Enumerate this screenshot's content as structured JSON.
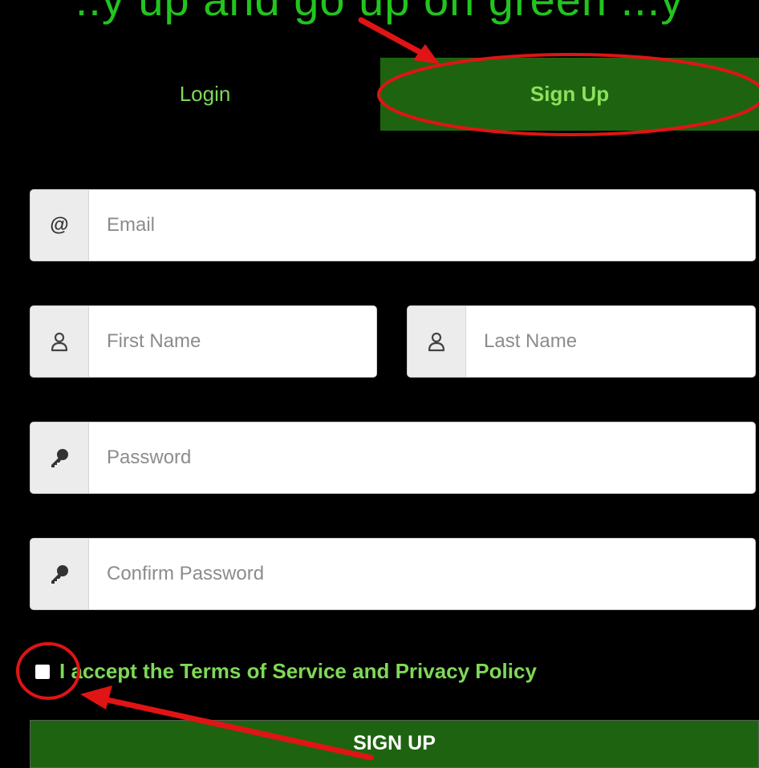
{
  "banner": {
    "text": "..y up and go up on green ...y"
  },
  "tabs": [
    {
      "label": "Login",
      "active": false
    },
    {
      "label": "Sign Up",
      "active": true
    }
  ],
  "form": {
    "email": {
      "placeholder": "Email",
      "icon": "at-icon"
    },
    "first_name": {
      "placeholder": "First Name",
      "icon": "user-icon"
    },
    "last_name": {
      "placeholder": "Last Name",
      "icon": "user-icon"
    },
    "password": {
      "placeholder": "Password",
      "icon": "key-icon"
    },
    "confirm_password": {
      "placeholder": "Confirm Password",
      "icon": "key-icon"
    },
    "terms_label": "I accept the Terms of Service and Privacy Policy",
    "submit_label": "SIGN UP"
  },
  "colors": {
    "accent": "#1e6410",
    "tab_text": "#7ed957",
    "annotation": "#e01414"
  }
}
